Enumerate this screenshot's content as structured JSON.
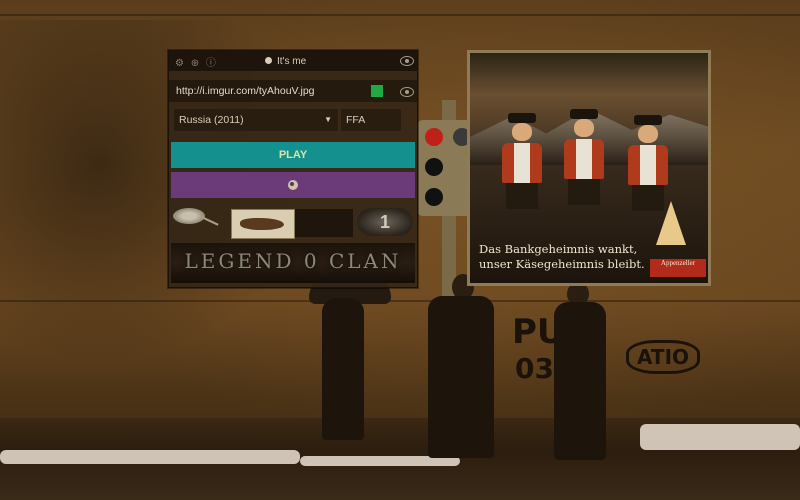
{
  "top_bar": {
    "icons": [
      "settings-icon",
      "globe-icon",
      "info-icon"
    ],
    "icon_glyphs": "⚙ ⊕ ⓘ",
    "nickname_value": "It's me",
    "show_icon": "eye-icon"
  },
  "skin": {
    "url_value": "http://i.imgur.com/tyAhouV.jpg",
    "color": "#1faa46"
  },
  "server_select": {
    "value": "Russia (2011)",
    "icon": "chevron-down-icon"
  },
  "mode_select": {
    "value": "FFA"
  },
  "buttons": {
    "play_label": "PLAY",
    "play_color": "#14908e",
    "spectate_color": "#6b3a78"
  },
  "banner": {
    "text": "LEGEND 0 CLAN"
  },
  "badge": {
    "text": "1"
  },
  "billboard": {
    "ad_line1": "Das Bankgeheimnis wankt,",
    "ad_line2": "unser Käsegeheimnis bleibt.",
    "brand": "Appenzeller"
  },
  "graffiti": {
    "tag1": "PUK",
    "tag2": "ATIO",
    "tag3": "03"
  }
}
